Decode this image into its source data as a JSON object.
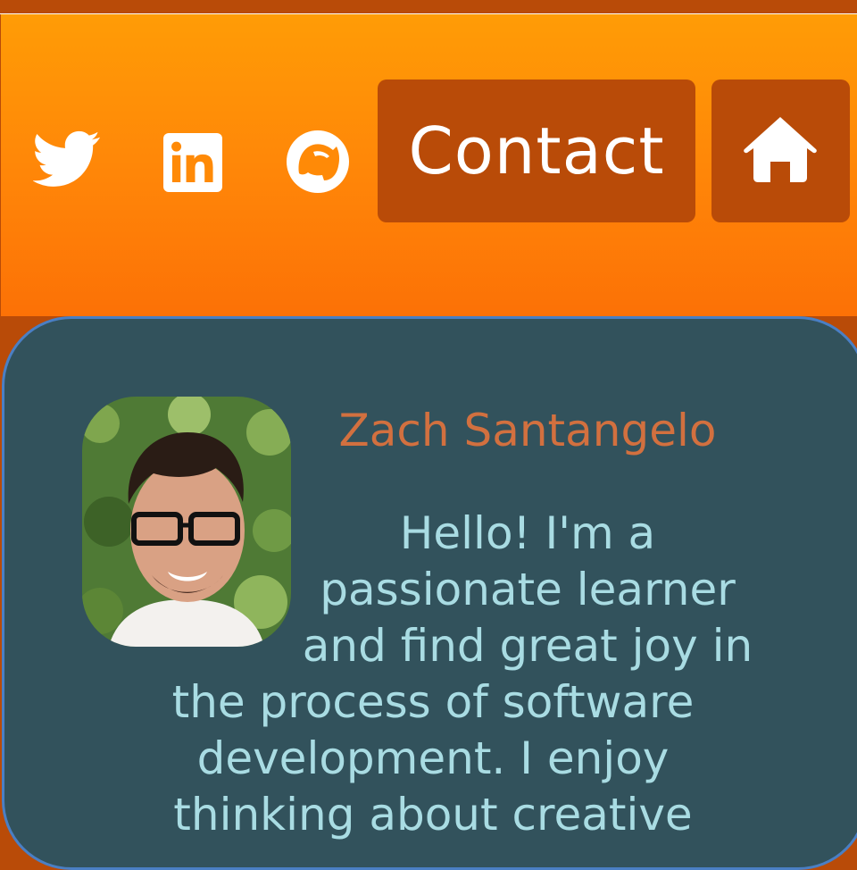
{
  "header": {
    "social_icons": [
      "twitter-icon",
      "linkedin-icon",
      "circle-logo-icon"
    ],
    "contact_label": "Contact",
    "home_icon": "home-icon"
  },
  "profile": {
    "name": "Zach Santangelo",
    "bio_lines": [
      "Hello! I'm a",
      "passionate learner",
      "and find great joy in",
      "the process of software",
      "development. I enjoy",
      "thinking about creative"
    ]
  },
  "colors": {
    "header_orange": "#ff8c07",
    "accent_dark_orange": "#b94b08",
    "card_bg": "#32525c",
    "card_border": "#4a7fc4",
    "name_color": "#d2703f",
    "bio_color": "#a9dce3"
  }
}
